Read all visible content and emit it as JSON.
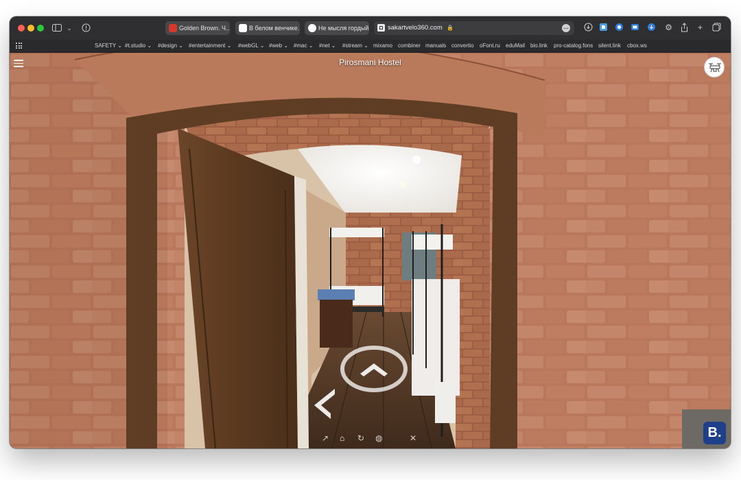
{
  "browser": {
    "tabs": [
      {
        "label": "Golden Brown. Ч...",
        "favicon": "red-flag-icon",
        "favicon_color": "#d33a2c"
      },
      {
        "label": "В белом венчике...",
        "favicon": "mic-icon",
        "favicon_color": "#ffffff"
      },
      {
        "label": "Не мысля гордый...",
        "favicon": "google-icon",
        "favicon_color": "#ffffff"
      }
    ],
    "active_tab": {
      "url": "sakartvelo360.com",
      "secure_icon": "lock-icon"
    },
    "toolbar_icons": [
      "sidebar-icon",
      "chevron-down-icon",
      "shield-icon",
      "more-icon",
      "download-icon",
      "extension-icon",
      "record-icon",
      "video-icon",
      "save-icon",
      "settings-icon",
      "share-icon",
      "new-tab-icon",
      "tabs-overview-icon"
    ]
  },
  "bookmarks": [
    {
      "label": "SAFETY",
      "has_chevron": true
    },
    {
      "label": "#t.studio",
      "has_chevron": true
    },
    {
      "label": "#design",
      "has_chevron": true
    },
    {
      "label": "#entertainment",
      "has_chevron": true
    },
    {
      "label": "#webGL",
      "has_chevron": true
    },
    {
      "label": "#web",
      "has_chevron": true
    },
    {
      "label": "#mac",
      "has_chevron": true
    },
    {
      "label": "#net",
      "has_chevron": true
    },
    {
      "label": "#stream",
      "has_chevron": true
    },
    {
      "label": "mixamo",
      "has_chevron": false
    },
    {
      "label": "combiner",
      "has_chevron": false
    },
    {
      "label": "manuals",
      "has_chevron": false
    },
    {
      "label": "convertio",
      "has_chevron": false
    },
    {
      "label": "oFont.ru",
      "has_chevron": false
    },
    {
      "label": "eduMail",
      "has_chevron": false
    },
    {
      "label": "bio.link",
      "has_chevron": false
    },
    {
      "label": "pro-catalog.fons",
      "has_chevron": false
    },
    {
      "label": "silent.link",
      "has_chevron": false
    },
    {
      "label": "cbox.ws",
      "has_chevron": false
    }
  ],
  "tour": {
    "title": "Pirosmani Hostel",
    "logo_icon": "drone-icon",
    "menu_icon": "menu-icon",
    "nav_forward_icon": "chevron-up-icon",
    "nav_left_icon": "chevron-left-icon",
    "bottom_controls": [
      "arrow-icon",
      "home-icon",
      "rotate-icon",
      "globe-icon",
      "close-icon"
    ],
    "booking_badge": "B."
  },
  "colors": {
    "brick": "#b06b4e",
    "door": "#5a3a22",
    "booking_blue": "#1f3f8a"
  }
}
